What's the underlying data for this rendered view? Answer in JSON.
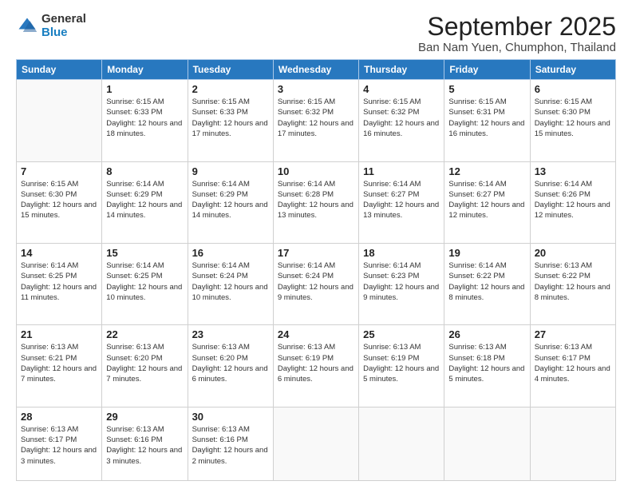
{
  "logo": {
    "general": "General",
    "blue": "Blue"
  },
  "title": {
    "month_year": "September 2025",
    "location": "Ban Nam Yuen, Chumphon, Thailand"
  },
  "days_of_week": [
    "Sunday",
    "Monday",
    "Tuesday",
    "Wednesday",
    "Thursday",
    "Friday",
    "Saturday"
  ],
  "weeks": [
    [
      {
        "day": "",
        "sunrise": "",
        "sunset": "",
        "daylight": ""
      },
      {
        "day": "1",
        "sunrise": "Sunrise: 6:15 AM",
        "sunset": "Sunset: 6:33 PM",
        "daylight": "Daylight: 12 hours and 18 minutes."
      },
      {
        "day": "2",
        "sunrise": "Sunrise: 6:15 AM",
        "sunset": "Sunset: 6:33 PM",
        "daylight": "Daylight: 12 hours and 17 minutes."
      },
      {
        "day": "3",
        "sunrise": "Sunrise: 6:15 AM",
        "sunset": "Sunset: 6:32 PM",
        "daylight": "Daylight: 12 hours and 17 minutes."
      },
      {
        "day": "4",
        "sunrise": "Sunrise: 6:15 AM",
        "sunset": "Sunset: 6:32 PM",
        "daylight": "Daylight: 12 hours and 16 minutes."
      },
      {
        "day": "5",
        "sunrise": "Sunrise: 6:15 AM",
        "sunset": "Sunset: 6:31 PM",
        "daylight": "Daylight: 12 hours and 16 minutes."
      },
      {
        "day": "6",
        "sunrise": "Sunrise: 6:15 AM",
        "sunset": "Sunset: 6:30 PM",
        "daylight": "Daylight: 12 hours and 15 minutes."
      }
    ],
    [
      {
        "day": "7",
        "sunrise": "Sunrise: 6:15 AM",
        "sunset": "Sunset: 6:30 PM",
        "daylight": "Daylight: 12 hours and 15 minutes."
      },
      {
        "day": "8",
        "sunrise": "Sunrise: 6:14 AM",
        "sunset": "Sunset: 6:29 PM",
        "daylight": "Daylight: 12 hours and 14 minutes."
      },
      {
        "day": "9",
        "sunrise": "Sunrise: 6:14 AM",
        "sunset": "Sunset: 6:29 PM",
        "daylight": "Daylight: 12 hours and 14 minutes."
      },
      {
        "day": "10",
        "sunrise": "Sunrise: 6:14 AM",
        "sunset": "Sunset: 6:28 PM",
        "daylight": "Daylight: 12 hours and 13 minutes."
      },
      {
        "day": "11",
        "sunrise": "Sunrise: 6:14 AM",
        "sunset": "Sunset: 6:27 PM",
        "daylight": "Daylight: 12 hours and 13 minutes."
      },
      {
        "day": "12",
        "sunrise": "Sunrise: 6:14 AM",
        "sunset": "Sunset: 6:27 PM",
        "daylight": "Daylight: 12 hours and 12 minutes."
      },
      {
        "day": "13",
        "sunrise": "Sunrise: 6:14 AM",
        "sunset": "Sunset: 6:26 PM",
        "daylight": "Daylight: 12 hours and 12 minutes."
      }
    ],
    [
      {
        "day": "14",
        "sunrise": "Sunrise: 6:14 AM",
        "sunset": "Sunset: 6:25 PM",
        "daylight": "Daylight: 12 hours and 11 minutes."
      },
      {
        "day": "15",
        "sunrise": "Sunrise: 6:14 AM",
        "sunset": "Sunset: 6:25 PM",
        "daylight": "Daylight: 12 hours and 10 minutes."
      },
      {
        "day": "16",
        "sunrise": "Sunrise: 6:14 AM",
        "sunset": "Sunset: 6:24 PM",
        "daylight": "Daylight: 12 hours and 10 minutes."
      },
      {
        "day": "17",
        "sunrise": "Sunrise: 6:14 AM",
        "sunset": "Sunset: 6:24 PM",
        "daylight": "Daylight: 12 hours and 9 minutes."
      },
      {
        "day": "18",
        "sunrise": "Sunrise: 6:14 AM",
        "sunset": "Sunset: 6:23 PM",
        "daylight": "Daylight: 12 hours and 9 minutes."
      },
      {
        "day": "19",
        "sunrise": "Sunrise: 6:14 AM",
        "sunset": "Sunset: 6:22 PM",
        "daylight": "Daylight: 12 hours and 8 minutes."
      },
      {
        "day": "20",
        "sunrise": "Sunrise: 6:13 AM",
        "sunset": "Sunset: 6:22 PM",
        "daylight": "Daylight: 12 hours and 8 minutes."
      }
    ],
    [
      {
        "day": "21",
        "sunrise": "Sunrise: 6:13 AM",
        "sunset": "Sunset: 6:21 PM",
        "daylight": "Daylight: 12 hours and 7 minutes."
      },
      {
        "day": "22",
        "sunrise": "Sunrise: 6:13 AM",
        "sunset": "Sunset: 6:20 PM",
        "daylight": "Daylight: 12 hours and 7 minutes."
      },
      {
        "day": "23",
        "sunrise": "Sunrise: 6:13 AM",
        "sunset": "Sunset: 6:20 PM",
        "daylight": "Daylight: 12 hours and 6 minutes."
      },
      {
        "day": "24",
        "sunrise": "Sunrise: 6:13 AM",
        "sunset": "Sunset: 6:19 PM",
        "daylight": "Daylight: 12 hours and 6 minutes."
      },
      {
        "day": "25",
        "sunrise": "Sunrise: 6:13 AM",
        "sunset": "Sunset: 6:19 PM",
        "daylight": "Daylight: 12 hours and 5 minutes."
      },
      {
        "day": "26",
        "sunrise": "Sunrise: 6:13 AM",
        "sunset": "Sunset: 6:18 PM",
        "daylight": "Daylight: 12 hours and 5 minutes."
      },
      {
        "day": "27",
        "sunrise": "Sunrise: 6:13 AM",
        "sunset": "Sunset: 6:17 PM",
        "daylight": "Daylight: 12 hours and 4 minutes."
      }
    ],
    [
      {
        "day": "28",
        "sunrise": "Sunrise: 6:13 AM",
        "sunset": "Sunset: 6:17 PM",
        "daylight": "Daylight: 12 hours and 3 minutes."
      },
      {
        "day": "29",
        "sunrise": "Sunrise: 6:13 AM",
        "sunset": "Sunset: 6:16 PM",
        "daylight": "Daylight: 12 hours and 3 minutes."
      },
      {
        "day": "30",
        "sunrise": "Sunrise: 6:13 AM",
        "sunset": "Sunset: 6:16 PM",
        "daylight": "Daylight: 12 hours and 2 minutes."
      },
      {
        "day": "",
        "sunrise": "",
        "sunset": "",
        "daylight": ""
      },
      {
        "day": "",
        "sunrise": "",
        "sunset": "",
        "daylight": ""
      },
      {
        "day": "",
        "sunrise": "",
        "sunset": "",
        "daylight": ""
      },
      {
        "day": "",
        "sunrise": "",
        "sunset": "",
        "daylight": ""
      }
    ]
  ]
}
